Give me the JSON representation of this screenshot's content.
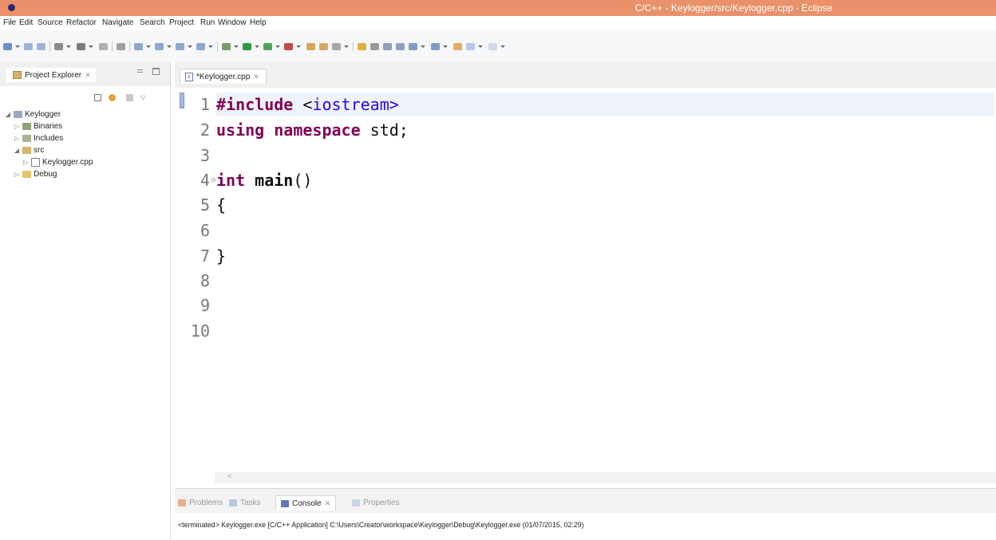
{
  "window": {
    "title": "C/C++ - Keylogger/src/Keylogger.cpp - Eclipse"
  },
  "menu": [
    "File",
    "Edit",
    "Source",
    "Refactor",
    "Navigate",
    "Search",
    "Project",
    "Run",
    "Window",
    "Help"
  ],
  "toolbar": {
    "icons": [
      "new-icon",
      "save-icon",
      "save-all-icon",
      "build-icon",
      "debug-icon",
      "run-icon",
      "external-tools-icon"
    ]
  },
  "project_explorer": {
    "title": "Project Explorer",
    "close_symbol": "✕",
    "tree": [
      {
        "label": "Keylogger",
        "twisty": "◢",
        "icon": "project-icon"
      },
      {
        "label": "Binaries",
        "twisty": "▷",
        "icon": "binaries-icon"
      },
      {
        "label": "Includes",
        "twisty": "▷",
        "icon": "includes-icon"
      },
      {
        "label": "src",
        "twisty": "◢",
        "icon": "folder-icon"
      },
      {
        "label": "Keylogger.cpp",
        "twisty": "▷",
        "icon": "cpp-file-icon"
      },
      {
        "label": "Debug",
        "twisty": "▷",
        "icon": "folder-icon"
      }
    ]
  },
  "editor": {
    "tab_label": "*Keylogger.cpp",
    "tab_close": "✕",
    "file_icon": "c",
    "line_numbers": [
      "1",
      "2",
      "3",
      "4",
      "5",
      "6",
      "7",
      "8",
      "9",
      "10"
    ],
    "lines": {
      "l1_kw": "#include",
      "l1_space": " <",
      "l1_inc": "iostream>",
      "l2_kw1": "using",
      "l2_kw2": "namespace",
      "l2_rest": " std;",
      "l4_kw": "int",
      "l4_fn": "main",
      "l4_rest": "()",
      "l5": "{",
      "l7": "}"
    },
    "scroll_arrow": "<"
  },
  "bottom_panel": {
    "tabs": [
      {
        "label": "Problems",
        "icon": "problems-icon"
      },
      {
        "label": "Tasks",
        "icon": "tasks-icon"
      },
      {
        "label": "Console",
        "icon": "console-icon",
        "active": true
      },
      {
        "label": "Properties",
        "icon": "properties-icon"
      }
    ],
    "console_close": "✕",
    "console_text": "<terminated> Keylogger.exe [C/C++ Application] C:\\Users\\Creator\\workspace\\Keylogger\\Debug\\Keylogger.exe (01/07/2015, 02:29)"
  },
  "colors": {
    "title_bar": "#e8916a",
    "keyword": "#7f0055",
    "include_path": "#2a00ff"
  }
}
